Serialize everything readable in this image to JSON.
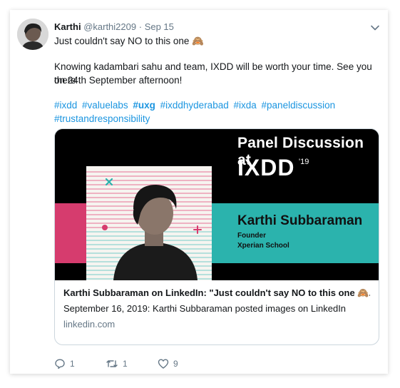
{
  "tweet": {
    "author_name": "Karthi",
    "author_handle": "@karthi2209",
    "separator": "·",
    "date": "Sep 15",
    "text_line1": "Just couldn't say NO to this one 🙈",
    "text_line2": "Knowing kadambari sahu and team, IXDD will be worth your time. See you there",
    "text_line3": "on 24th September afternoon!",
    "hashtags_line1": [
      "#ixdd",
      "#valuelabs",
      "#uxg",
      "#ixddhyderabad",
      "#ixda",
      "#paneldiscussion"
    ],
    "hashtags_line2": [
      "#trustandresponsibility"
    ]
  },
  "banner": {
    "heading": "Panel Discussion at",
    "brand": "IXDD",
    "brand_superscript": "'19",
    "speaker_name": "Karthi Subbaraman",
    "speaker_role": "Founder",
    "speaker_company": "Xperian School"
  },
  "link_card": {
    "title": "Karthi Subbaraman on LinkedIn: \"Just couldn't say NO to this one 🙈...",
    "description": "September 16, 2019: Karthi Subbaraman posted images on LinkedIn",
    "domain": "linkedin.com"
  },
  "actions": {
    "reply_count": "1",
    "retweet_count": "1",
    "like_count": "9"
  },
  "icons": {
    "reply": "reply-icon",
    "retweet": "retweet-icon",
    "like": "like-icon",
    "more": "chevron-down-icon"
  },
  "colors": {
    "link_blue": "#1b95e0",
    "muted": "#657786",
    "teal": "#2bb3ad",
    "magenta": "#d63c6e",
    "banner_bg": "#000000"
  }
}
